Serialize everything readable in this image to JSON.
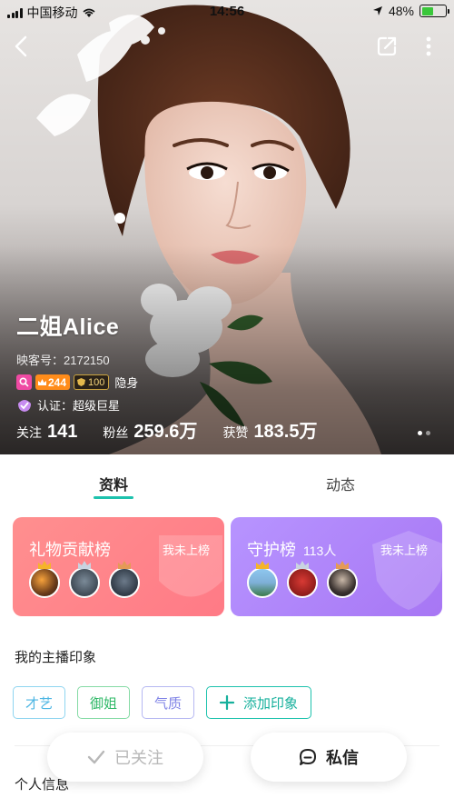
{
  "status_bar": {
    "carrier": "中国移动",
    "time": "14:56",
    "battery": "48%",
    "battery_level": 0.48
  },
  "profile": {
    "name": "二姐Alice",
    "id_line": "映客号：2172150",
    "level": "244",
    "crown_level": "100",
    "hidden_label": "隐身",
    "certification": "认证：超级巨星",
    "stats": [
      {
        "key": "关注",
        "value": "141"
      },
      {
        "key": "粉丝",
        "value": "259.6万"
      },
      {
        "key": "获赞",
        "value": "183.5万"
      }
    ]
  },
  "tabs": [
    {
      "label": "资料",
      "active": true
    },
    {
      "label": "动态",
      "active": false
    }
  ],
  "cards": {
    "gift": {
      "title": "礼物贡献榜",
      "status": "我未上榜"
    },
    "guard": {
      "title": "守护榜",
      "count": "113人",
      "status": "我未上榜"
    }
  },
  "impressions": {
    "title": "我的主播印象",
    "tags": [
      "才艺",
      "御姐",
      "气质"
    ],
    "add_label": "添加印象"
  },
  "personal_info_title": "个人信息",
  "actions": {
    "follow_label": "已关注",
    "message_label": "私信"
  },
  "colors": {
    "accent": "#1dc2ad",
    "gift_card": "#ff8a8a",
    "guard_card": "#b08af8"
  }
}
